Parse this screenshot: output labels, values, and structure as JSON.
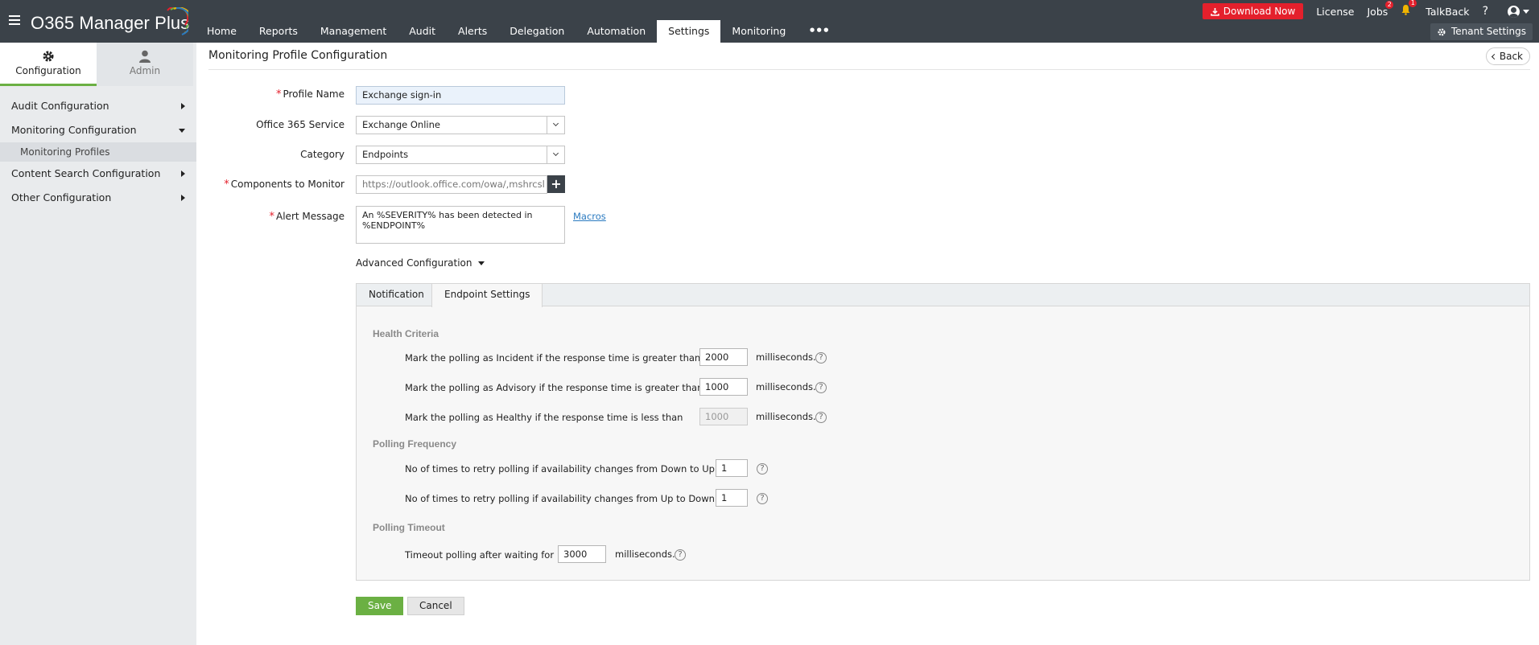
{
  "app": {
    "title": "O365 Manager Plus"
  },
  "nav": {
    "items": [
      {
        "label": "Home"
      },
      {
        "label": "Reports"
      },
      {
        "label": "Management"
      },
      {
        "label": "Audit"
      },
      {
        "label": "Alerts"
      },
      {
        "label": "Delegation"
      },
      {
        "label": "Automation"
      },
      {
        "label": "Settings",
        "active": true
      },
      {
        "label": "Monitoring"
      }
    ],
    "more_label": "•••"
  },
  "topbar": {
    "download_label": "Download Now",
    "license_label": "License",
    "jobs_label": "Jobs",
    "jobs_badge": "2",
    "bell_badge": "1",
    "talkback_label": "TalkBack",
    "help_label": "?",
    "tenant_settings_label": "Tenant Settings"
  },
  "sidebar": {
    "tabs": [
      {
        "label": "Configuration",
        "icon": "gear-icon",
        "active": true
      },
      {
        "label": "Admin",
        "icon": "user-icon",
        "active": false
      }
    ],
    "items": [
      {
        "label": "Audit Configuration"
      },
      {
        "label": "Monitoring Configuration"
      },
      {
        "label": "Monitoring Profiles"
      },
      {
        "label": "Content Search Configuration"
      },
      {
        "label": "Other Configuration"
      }
    ]
  },
  "page": {
    "title": "Monitoring Profile Configuration",
    "back_label": "Back"
  },
  "form": {
    "profile_name_label": "Profile Name",
    "profile_name_value": "Exchange sign-in",
    "service_label": "Office 365 Service",
    "service_value": "Exchange Online",
    "category_label": "Category",
    "category_value": "Endpoints",
    "components_label": "Components to Monitor",
    "components_value": "https://outlook.office.com/owa/,mshrcsl",
    "alert_label": "Alert Message",
    "alert_value": "An %SEVERITY% has been detected in %ENDPOINT%",
    "macros_label": "Macros",
    "advanced_label": "Advanced Configuration"
  },
  "tabs": {
    "notification": "Notification",
    "endpoint": "Endpoint Settings"
  },
  "health": {
    "heading": "Health Criteria",
    "incident_text": "Mark the polling as Incident if the response time is greater than",
    "incident_value": "2000",
    "advisory_text": "Mark the polling as Advisory if the response time is greater than",
    "advisory_value": "1000",
    "healthy_text": "Mark the polling as Healthy if the response time is less than",
    "healthy_value": "1000",
    "unit": "milliseconds."
  },
  "polling": {
    "heading": "Polling Frequency",
    "down_up_text": "No of times to retry polling if availability changes from Down to Up",
    "down_up_value": "1",
    "up_down_text": "No of times to retry polling if availability changes from Up to Down",
    "up_down_value": "1"
  },
  "timeout": {
    "heading": "Polling Timeout",
    "text": "Timeout polling after waiting for",
    "value": "3000",
    "unit": "milliseconds."
  },
  "actions": {
    "save": "Save",
    "cancel": "Cancel"
  },
  "colors": {
    "topbar": "#3b4249",
    "accent_green": "#6bb043",
    "download_red": "#e4202c",
    "link_blue": "#2a7ac0"
  }
}
